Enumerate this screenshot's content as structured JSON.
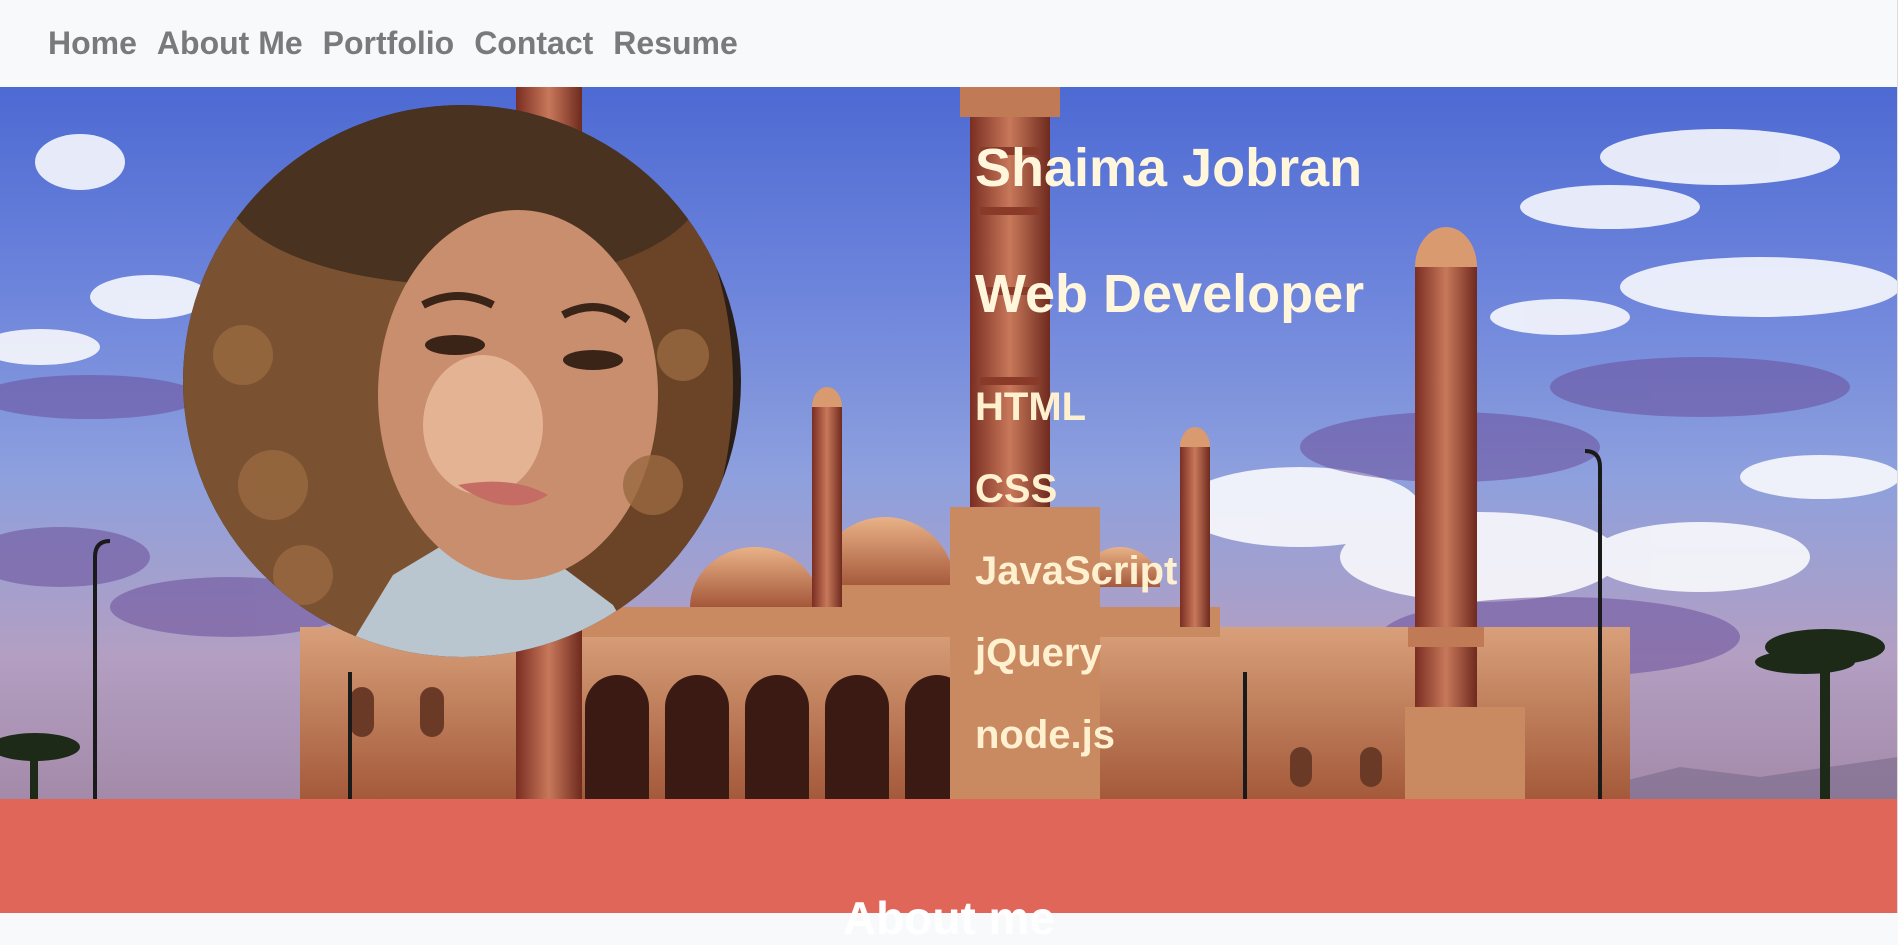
{
  "nav": {
    "items": [
      {
        "label": "Home"
      },
      {
        "label": "About Me"
      },
      {
        "label": "Portfolio"
      },
      {
        "label": "Contact"
      },
      {
        "label": "Resume"
      }
    ]
  },
  "hero": {
    "name": "Shaima Jobran",
    "role": "Web Developer",
    "skills": [
      "HTML",
      "CSS",
      "JavaScript",
      "jQuery",
      "node.js"
    ],
    "background_description_icon": "mosque-skyline-image",
    "portrait_icon": "profile-photo"
  },
  "about": {
    "title": "About me"
  },
  "colors": {
    "nav_bg": "#f8f9fa",
    "nav_text": "#7a7a7a",
    "hero_text": "#fff6dc",
    "about_bg": "#e0665a"
  }
}
